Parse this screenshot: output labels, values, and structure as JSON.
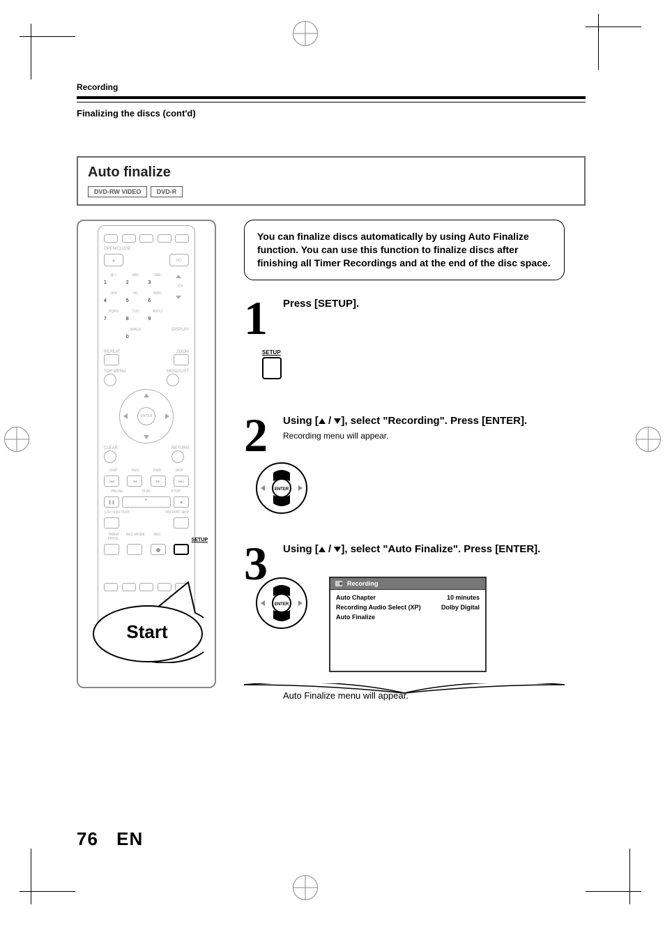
{
  "header": {
    "section": "Recording",
    "subtitle": "Finalizing the discs (cont'd)"
  },
  "feature": {
    "title": "Auto finalize",
    "badges": [
      "DVD-RW VIDEO",
      "DVD-R"
    ]
  },
  "remote": {
    "top_labels": {
      "open_close": "OPEN/CLOSE",
      "power": "I/⏻"
    },
    "keypad_row_labels": [
      [
        "@./:",
        "ABC",
        "DEF"
      ],
      [
        "GHI",
        "JKL",
        "MNO"
      ],
      [
        "PQRS",
        "TUV",
        "WXYZ"
      ],
      [
        "",
        "SPACE",
        ""
      ]
    ],
    "keypad": [
      [
        "1",
        "2",
        "3"
      ],
      [
        "4",
        "5",
        "6"
      ],
      [
        "7",
        "8",
        "9"
      ],
      [
        "",
        "0",
        ""
      ]
    ],
    "ch_label": "CH",
    "display_label": "DISPLAY",
    "repeat_label": "REPEAT",
    "zoom_label": "ZOOM",
    "topmenu_label": "TOP MENU",
    "menulist_label": "MENU/LIST",
    "enter_label": "ENTER",
    "clear_label": "CLEAR",
    "return_label": "RETURN",
    "transport_labels": {
      "skip_l": "SKIP",
      "rev": "REV",
      "fwd": "FWD",
      "skip_r": "SKIP",
      "pause": "PAUSE",
      "play": "PLAY",
      "stop": "STOP",
      "speed": "1.3x / 0.8x PLAY",
      "instant": "INSTANT SKIP"
    },
    "bottom_labels": {
      "timer": "TIMER\nPROG.",
      "recmode": "REC MODE",
      "rec": "REC",
      "setup": "SETUP"
    },
    "bubble": "Start"
  },
  "intro": "You can finalize discs automatically by using  Auto Finalize function. You can use this function to finalize discs after finishing all Timer Recordings and at the end of the disc space.",
  "steps": {
    "s1": {
      "num": "1",
      "title": "Press [SETUP].",
      "icon_label": "SETUP"
    },
    "s2": {
      "num": "2",
      "title_pre": "Using [",
      "title_mid": " / ",
      "title_post": "], select \"Recording\". Press [ENTER].",
      "sub": "Recording menu will appear."
    },
    "s3": {
      "num": "3",
      "title_pre": "Using [",
      "title_mid": " / ",
      "title_post": "], select \"Auto Finalize\". Press [ENTER].",
      "menu_title": "Recording",
      "rows": [
        {
          "k": "Auto Chapter",
          "v": "10 minutes"
        },
        {
          "k": "Recording Audio Select (XP)",
          "v": "Dolby Digital"
        },
        {
          "k": "Auto Finalize",
          "v": ""
        }
      ],
      "after": "Auto Finalize menu will appear."
    }
  },
  "footer": {
    "page": "76",
    "lang": "EN"
  }
}
